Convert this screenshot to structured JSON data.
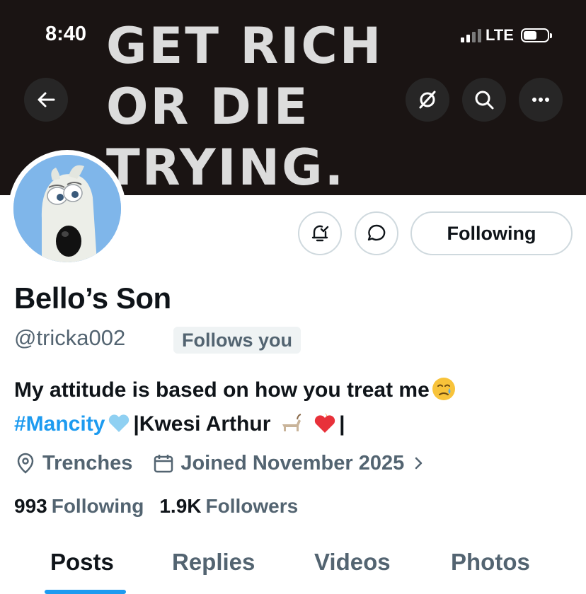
{
  "status_bar": {
    "time": "8:40",
    "network": "LTE"
  },
  "banner": {
    "lines": [
      "GET RICH",
      "OR DIE",
      "TRYING."
    ]
  },
  "header_buttons": {
    "back_icon": "arrow-left-icon",
    "grok_icon": "slashed-circle-icon",
    "search_icon": "search-icon",
    "more_icon": "ellipsis-icon"
  },
  "actions": {
    "following_label": "Following"
  },
  "profile": {
    "name": "Bello’s Son",
    "handle": "@tricka002",
    "follows_you": "Follows you",
    "bio": {
      "line1": "My attitude is based on how you treat me",
      "hashtag": "#Mancity",
      "line2_rest": "|Kwesi Arthur",
      "line2_end": "|"
    },
    "location": "Trenches",
    "joined": "Joined November 2025"
  },
  "stats": {
    "following_count": "993",
    "following_label": "Following",
    "followers_count": "1.9K",
    "followers_label": "Followers"
  },
  "tabs": [
    "Posts",
    "Replies",
    "Videos",
    "Photos"
  ],
  "colors": {
    "accent": "#1d9bf0",
    "secondary_text": "#536471",
    "banner_bg": "#1a1413"
  }
}
